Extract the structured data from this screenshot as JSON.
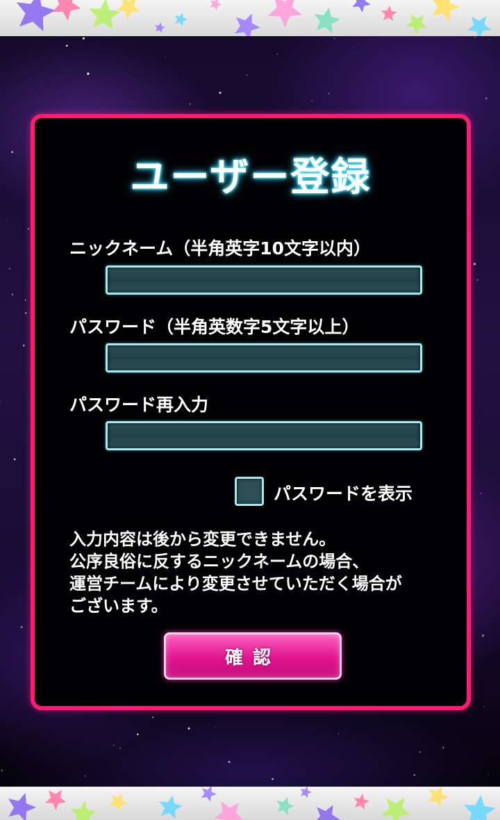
{
  "title": "ユーザー登録",
  "fields": {
    "nickname": {
      "label": "ニックネーム（半角英字10文字以内）",
      "value": ""
    },
    "password": {
      "label": "パスワード（半角英数字5文字以上）",
      "value": ""
    },
    "password_confirm": {
      "label": "パスワード再入力",
      "value": ""
    }
  },
  "show_password": {
    "label": "パスワードを表示",
    "checked": false
  },
  "notice": [
    "入力内容は後から変更できません。",
    "公序良俗に反するニックネームの場合、",
    "運営チームにより変更させていただく場合が",
    "ございます。"
  ],
  "confirm_button": "確認",
  "colors": {
    "panel_border": "#ff1a73",
    "field_border": "#a7e9ee",
    "field_fill": "#2b4f55",
    "button": "#e0148f",
    "title_glow": "#4fe6ff"
  },
  "icons": [
    "star-decoration-icon"
  ]
}
